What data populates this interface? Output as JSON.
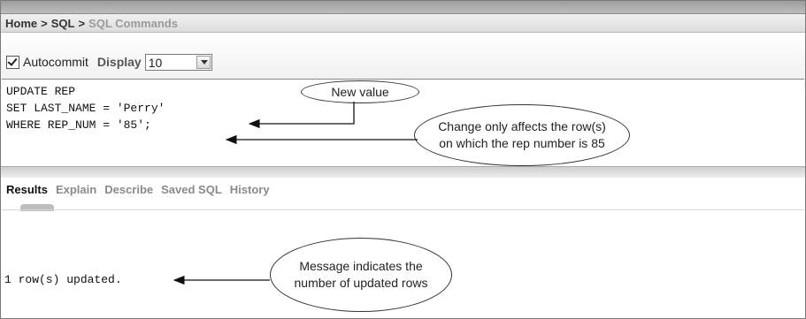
{
  "breadcrumb": {
    "home": "Home",
    "sql": "SQL",
    "current": "SQL Commands",
    "separator": ">"
  },
  "options": {
    "autocommit_label": "Autocommit",
    "autocommit_checked": true,
    "display_label": "Display",
    "display_value": "10"
  },
  "editor": {
    "lines": [
      "UPDATE REP",
      "SET LAST_NAME = 'Perry'",
      "WHERE REP_NUM = '85';"
    ]
  },
  "tabs": [
    "Results",
    "Explain",
    "Describe",
    "Saved SQL",
    "History"
  ],
  "output": {
    "message": "1 row(s) updated."
  },
  "callouts": {
    "new_value": "New value",
    "change_affects": "Change only affects the row(s) on which the rep number is 85",
    "message": "Message indicates the number of updated rows"
  }
}
